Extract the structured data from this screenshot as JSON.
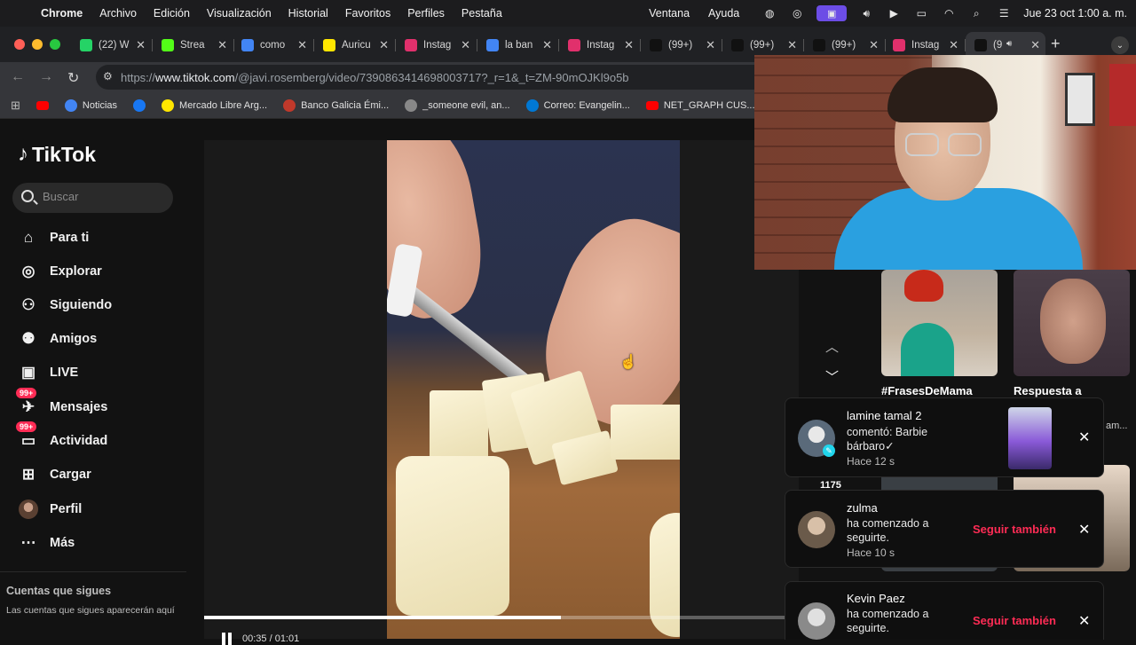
{
  "menubar": {
    "app": "Chrome",
    "items": [
      "Archivo",
      "Edición",
      "Visualización",
      "Historial",
      "Favoritos",
      "Perfiles",
      "Pestaña"
    ],
    "right_items": [
      "Ventana",
      "Ayuda"
    ],
    "datetime": "Jue 23 oct  1:00 a. m."
  },
  "tabs": [
    {
      "title": "(22) W",
      "icon": "whatsapp-icon",
      "color": "#25d366"
    },
    {
      "title": "Strea",
      "icon": "kick-icon",
      "color": "#53fc18"
    },
    {
      "title": "como",
      "icon": "google-icon",
      "color": "#4285f4"
    },
    {
      "title": "Auricu",
      "icon": "mercadolibre-icon",
      "color": "#ffe600"
    },
    {
      "title": "Instag",
      "icon": "instagram-icon",
      "color": "#e1306c"
    },
    {
      "title": "la ban",
      "icon": "google-icon",
      "color": "#4285f4"
    },
    {
      "title": "Instag",
      "icon": "instagram-icon",
      "color": "#e1306c"
    },
    {
      "title": "(99+)",
      "icon": "tiktok-icon",
      "color": "#111111"
    },
    {
      "title": "(99+)",
      "icon": "tiktok-icon",
      "color": "#111111"
    },
    {
      "title": "(99+)",
      "icon": "tiktok-icon",
      "color": "#111111"
    },
    {
      "title": "Instag",
      "icon": "instagram-icon",
      "color": "#e1306c"
    },
    {
      "title": "(9",
      "icon": "tiktok-icon",
      "color": "#111111"
    }
  ],
  "address": {
    "url_prefix": "https://",
    "url_host": "www.tiktok.com",
    "url_path": "/@javi.rosemberg/video/7390863414698003717?_r=1&_t=ZM-90mOJKl9o5b"
  },
  "bookmarks": [
    {
      "label": "",
      "icon": "youtube-icon",
      "color": "#ff0000"
    },
    {
      "label": "Noticias",
      "icon": "google-icon",
      "color": "#4285f4"
    },
    {
      "label": "",
      "icon": "facebook-icon",
      "color": "#1877f2"
    },
    {
      "label": "Mercado Libre Arg...",
      "icon": "mercadolibre-icon",
      "color": "#ffe600"
    },
    {
      "label": "Banco Galicia Émi...",
      "icon": "galicia-icon",
      "color": "#c0392b"
    },
    {
      "label": "_someone evil, an...",
      "icon": "globe-icon",
      "color": "#888888"
    },
    {
      "label": "Correo: Evangelin...",
      "icon": "outlook-icon",
      "color": "#0078d4"
    },
    {
      "label": "NET_GRAPH CUS...",
      "icon": "youtube-icon",
      "color": "#ff0000"
    }
  ],
  "tiktok": {
    "logo": "TikTok",
    "search_placeholder": "Buscar",
    "nav": [
      {
        "label": "Para ti",
        "icon": "home-icon"
      },
      {
        "label": "Explorar",
        "icon": "compass-icon"
      },
      {
        "label": "Siguiendo",
        "icon": "following-icon"
      },
      {
        "label": "Amigos",
        "icon": "friends-icon"
      },
      {
        "label": "LIVE",
        "icon": "live-icon"
      },
      {
        "label": "Mensajes",
        "icon": "messages-icon",
        "badge": "99+"
      },
      {
        "label": "Actividad",
        "icon": "activity-icon",
        "badge": "99+"
      },
      {
        "label": "Cargar",
        "icon": "upload-icon"
      },
      {
        "label": "Perfil",
        "icon": "profile-avatar"
      },
      {
        "label": "Más",
        "icon": "more-icon"
      }
    ],
    "following_title": "Cuentas que sigues",
    "following_desc": "Las cuentas que sigues aparecerán aquí",
    "video": {
      "time": "00:35 / 01:01",
      "progress": 0.6
    },
    "related": [
      {
        "caption": "#FrasesDeMama"
      },
      {
        "caption": "Respuesta a"
      }
    ],
    "count_label": "1175",
    "truncated_label": "am..."
  },
  "notifications": [
    {
      "name": "lamine tamal 2",
      "message": "comentó: Barbie bárbaro✓",
      "time": "Hace 12 s"
    },
    {
      "name": "zulma",
      "message": "ha comenzado a seguirte.",
      "time": "Hace 10 s",
      "action": "Seguir también"
    },
    {
      "name": "Kevin Paez",
      "message": "ha comenzado a seguirte.",
      "action": "Seguir también"
    }
  ]
}
